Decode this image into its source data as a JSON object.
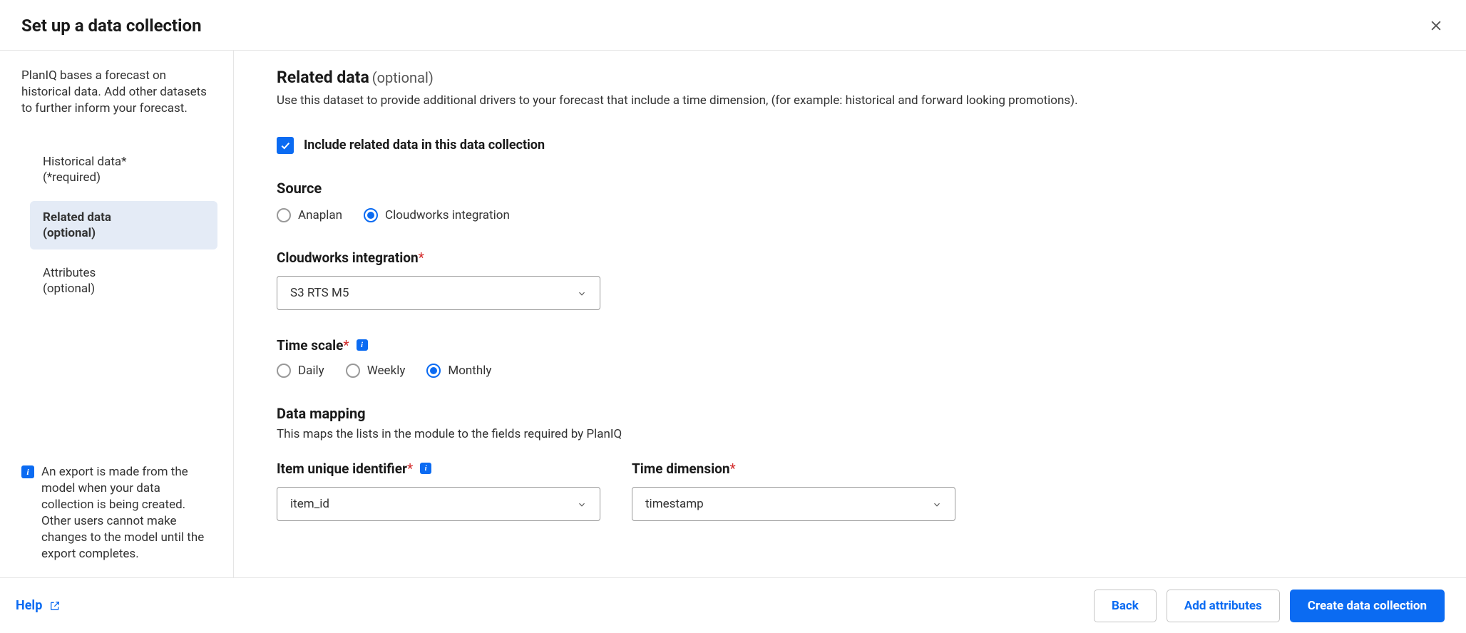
{
  "header": {
    "title": "Set up a data collection"
  },
  "sidebar": {
    "description": "PlanIQ bases a forecast on historical data. Add other datasets to further inform your forecast.",
    "nav": [
      {
        "line1": "Historical data*",
        "line2": "(*required)"
      },
      {
        "line1": "Related data",
        "line2": "(optional)"
      },
      {
        "line1": "Attributes",
        "line2": "(optional)"
      }
    ],
    "info_text": "An export is made from the model when your data collection is being created. Other users cannot make changes to the model until the export completes."
  },
  "main": {
    "related_data": {
      "title": "Related data",
      "title_suffix": "(optional)",
      "description": "Use this dataset to provide additional drivers to your forecast that include a time dimension, (for example: historical and forward looking promotions).",
      "include_checkbox_label": "Include related data in this data collection",
      "include_checked": true
    },
    "source": {
      "title": "Source",
      "options": [
        "Anaplan",
        "Cloudworks integration"
      ],
      "selected": "Cloudworks integration"
    },
    "cloudworks": {
      "label": "Cloudworks integration",
      "value": "S3 RTS M5"
    },
    "time_scale": {
      "label": "Time scale",
      "options": [
        "Daily",
        "Weekly",
        "Monthly"
      ],
      "selected": "Monthly"
    },
    "data_mapping": {
      "title": "Data mapping",
      "description": "This maps the lists in the module to the fields required by PlanIQ",
      "item_id": {
        "label": "Item unique identifier",
        "value": "item_id"
      },
      "time_dim": {
        "label": "Time dimension",
        "value": "timestamp"
      }
    }
  },
  "footer": {
    "help_label": "Help",
    "buttons": {
      "back": "Back",
      "add_attributes": "Add attributes",
      "create": "Create data collection"
    }
  }
}
